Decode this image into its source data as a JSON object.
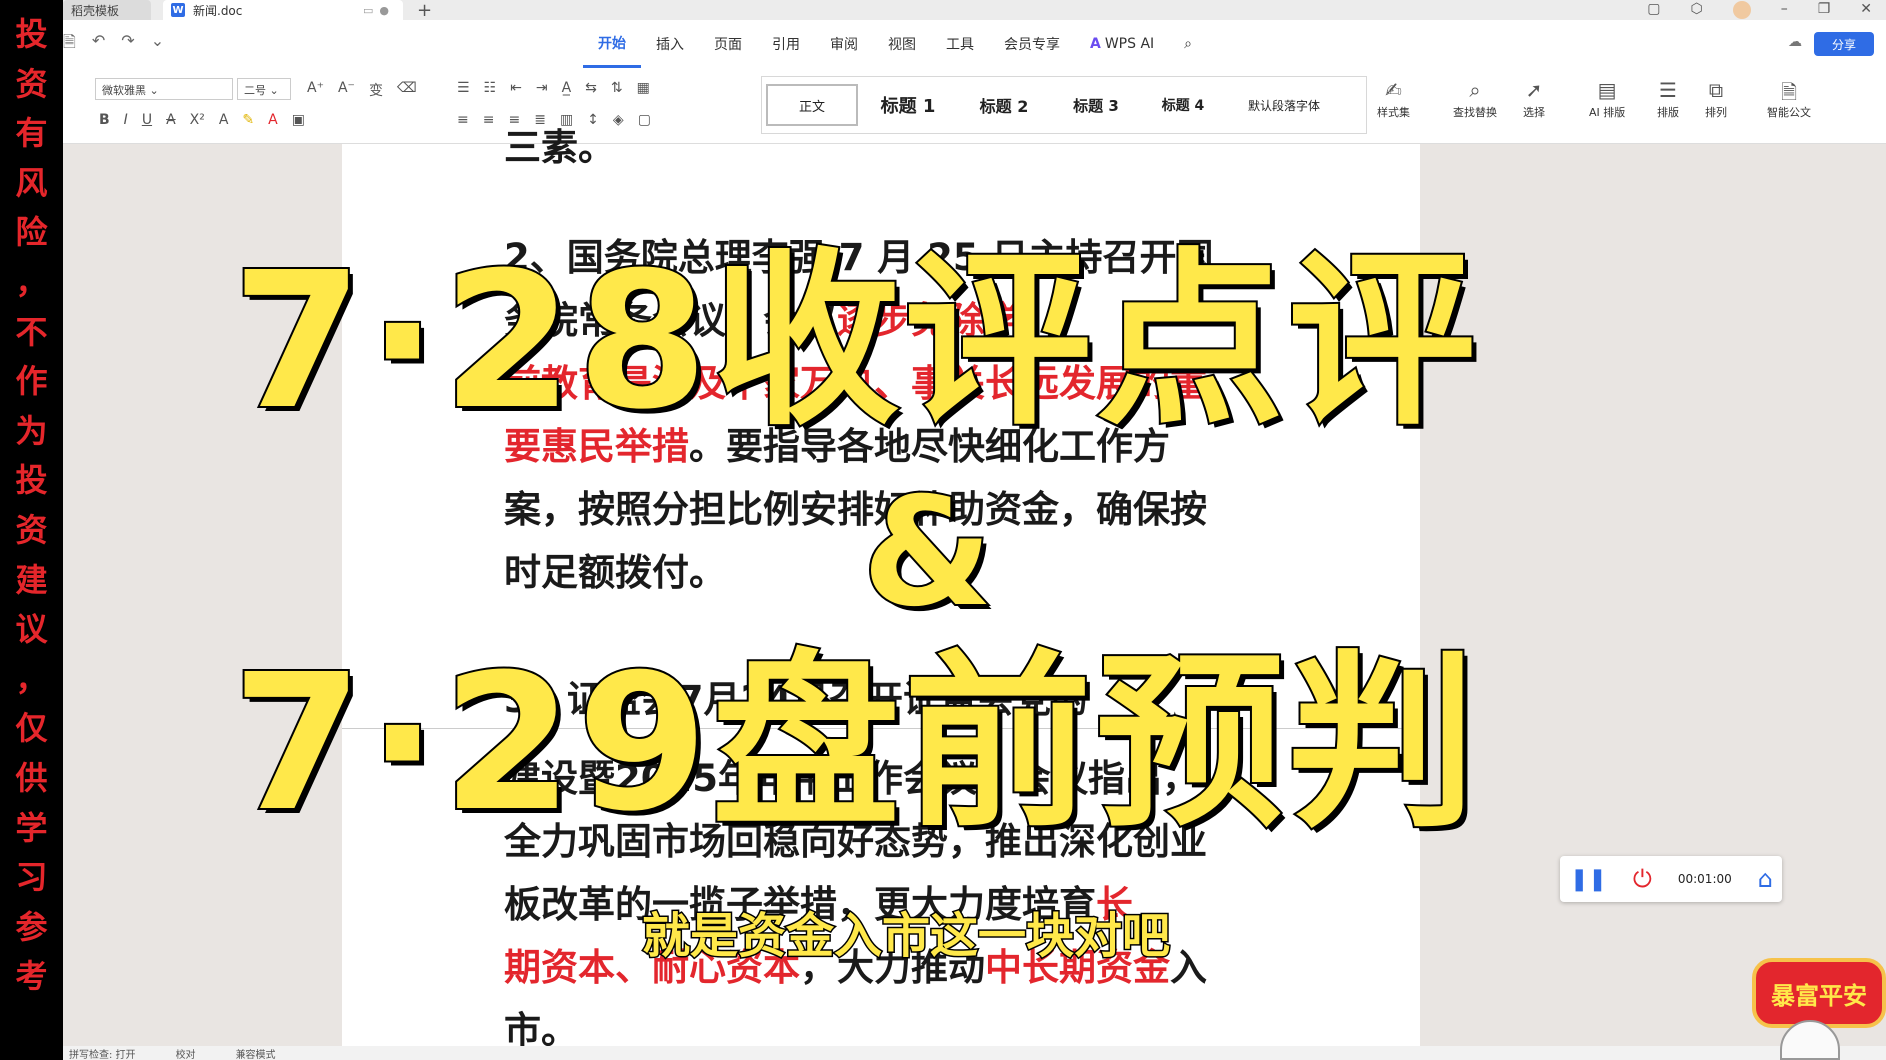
{
  "disclaimer": [
    "投",
    "资",
    "有",
    "风",
    "险",
    "，",
    "不",
    "作",
    "为",
    "投",
    "资",
    "建",
    "议",
    "，",
    "仅",
    "供",
    "学",
    "习",
    "参",
    "考"
  ],
  "titlebar": {
    "tab_inactive": "稻壳模板",
    "tab_active": "新闻.doc",
    "doc_icon": "W",
    "new_tab": "+"
  },
  "menu": {
    "items": [
      "开始",
      "插入",
      "页面",
      "引用",
      "审阅",
      "视图",
      "工具",
      "会员专享"
    ],
    "wps_ai": "WPS AI",
    "share": "分享"
  },
  "ribbon": {
    "font_name": "微软雅黑",
    "font_size": "二号",
    "styles": [
      "正文",
      "标题 1",
      "标题 2",
      "标题 3",
      "标题 4",
      "默认段落字体"
    ],
    "tools": [
      "样式集",
      "查找替换",
      "选择",
      "AI 排版",
      "排版",
      "排列",
      "智能公文"
    ]
  },
  "document": {
    "top_fragment": "三素。",
    "para2": {
      "l1": "2、国务院总理李强 7 月 25 日主持召开国",
      "l2a": "务院常务会议，会议",
      "l2b": "逐步免除学",
      "l3": "前教育是涉及千家万户、事关长远发展的重",
      "l4a": "要惠民举措",
      "l4b": "。要指导各地尽快细化工作方",
      "l5": "案，按照分担比例安排好补助资金，确保按",
      "l6": "时足额拨付。"
    },
    "para3": {
      "l1": "3、证监会7月24日召开证监会党的",
      "l2": "建设暨2025年年中工作会议，会议指出，",
      "l3": "全力巩固市场回稳向好态势，推出深化创业",
      "l4a": "板改革的一揽子举措，更大力度培育",
      "l4b": "长",
      "l5a": "期资本、耐心资本",
      "l5b": "，大力推动",
      "l5c": "中长期资金",
      "l5d": "入",
      "l6": "市。"
    }
  },
  "overlay": {
    "line1": "7·28收评点评",
    "amp": "&",
    "line2": "7·29盘前预判"
  },
  "subtitle": "就是资金入市这一块对吧",
  "recorder": {
    "time": "00:01:00"
  },
  "badge": "暴富平安",
  "statusbar": [
    "拼写检查: 打开",
    "校对",
    "兼容模式"
  ]
}
